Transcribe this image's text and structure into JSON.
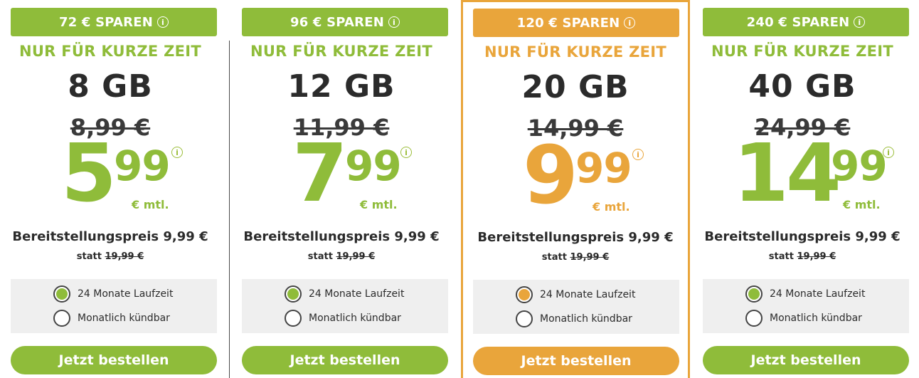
{
  "colors": {
    "accent_green": "#8fbc3a",
    "accent_orange": "#e9a53b",
    "text_dark": "#2b2b2b"
  },
  "plans": [
    {
      "savings": "72 € SPAREN",
      "promo": "NUR FÜR KURZE ZEIT",
      "volume": "8 GB",
      "old_price": "8,99 €",
      "price_euros": "5",
      "price_cents": "99",
      "price_unit": "€ mtl.",
      "setup_fee": "Bereitstellungspreis 9,99 €",
      "setup_instead": "statt",
      "setup_old": "19,99 €",
      "options": [
        "24 Monate Laufzeit",
        "Monatlich kündbar"
      ],
      "selected_option": "24 Monate Laufzeit",
      "cta": "Jetzt bestellen",
      "highlight": false
    },
    {
      "savings": "96 € SPAREN",
      "promo": "NUR FÜR KURZE ZEIT",
      "volume": "12 GB",
      "old_price": "11,99 €",
      "price_euros": "7",
      "price_cents": "99",
      "price_unit": "€ mtl.",
      "setup_fee": "Bereitstellungspreis 9,99 €",
      "setup_instead": "statt",
      "setup_old": "19,99 €",
      "options": [
        "24 Monate Laufzeit",
        "Monatlich kündbar"
      ],
      "selected_option": "24 Monate Laufzeit",
      "cta": "Jetzt bestellen",
      "highlight": false
    },
    {
      "savings": "120 € SPAREN",
      "promo": "NUR FÜR KURZE ZEIT",
      "volume": "20 GB",
      "old_price": "14,99 €",
      "price_euros": "9",
      "price_cents": "99",
      "price_unit": "€ mtl.",
      "setup_fee": "Bereitstellungspreis 9,99 €",
      "setup_instead": "statt",
      "setup_old": "19,99 €",
      "options": [
        "24 Monate Laufzeit",
        "Monatlich kündbar"
      ],
      "selected_option": "24 Monate Laufzeit",
      "cta": "Jetzt bestellen",
      "highlight": true
    },
    {
      "savings": "240 € SPAREN",
      "promo": "NUR FÜR KURZE ZEIT",
      "volume": "40 GB",
      "old_price": "24,99 €",
      "price_euros": "14",
      "price_cents": "99",
      "price_unit": "€ mtl.",
      "setup_fee": "Bereitstellungspreis 9,99 €",
      "setup_instead": "statt",
      "setup_old": "19,99 €",
      "options": [
        "24 Monate Laufzeit",
        "Monatlich kündbar"
      ],
      "selected_option": "24 Monate Laufzeit",
      "cta": "Jetzt bestellen",
      "highlight": false
    }
  ],
  "icons": {
    "info": "info-icon",
    "radio_selected": "radio-selected-icon",
    "radio_unselected": "radio-unselected-icon"
  }
}
